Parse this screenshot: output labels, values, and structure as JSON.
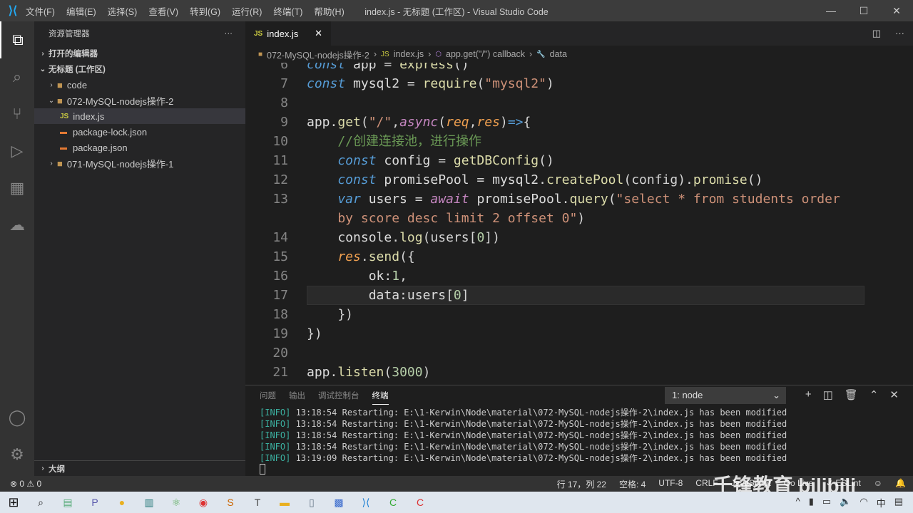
{
  "titlebar": {
    "menu": [
      "文件(F)",
      "编辑(E)",
      "选择(S)",
      "查看(V)",
      "转到(G)",
      "运行(R)",
      "终端(T)",
      "帮助(H)"
    ],
    "title": "index.js - 无标题 (工作区) - Visual Studio Code"
  },
  "sidebar": {
    "title": "资源管理器",
    "more": "···",
    "open_editors": "打开的编辑器",
    "workspace": "无标题 (工作区)",
    "items": [
      {
        "label": "code",
        "type": "folder",
        "depth": 1,
        "open": false
      },
      {
        "label": "072-MySQL-nodejs操作-2",
        "type": "folder",
        "depth": 1,
        "open": true
      },
      {
        "label": "index.js",
        "type": "js",
        "depth": 2,
        "selected": true
      },
      {
        "label": "package-lock.json",
        "type": "json",
        "depth": 2
      },
      {
        "label": "package.json",
        "type": "json",
        "depth": 2
      },
      {
        "label": "071-MySQL-nodejs操作-1",
        "type": "folder",
        "depth": 1,
        "open": false
      }
    ],
    "outline": "大纲"
  },
  "tab": {
    "icon": "JS",
    "label": "index.js",
    "close": "✕"
  },
  "breadcrumb": [
    "072-MySQL-nodejs操作-2",
    "index.js",
    "app.get(\"/\") callback",
    "data"
  ],
  "code": [
    {
      "n": "6",
      "t": [
        [
          "const ",
          "kw"
        ],
        [
          "app ",
          "v"
        ],
        [
          "= ",
          "p"
        ],
        [
          "express",
          "fn"
        ],
        [
          "()",
          "p"
        ]
      ]
    },
    {
      "n": "7",
      "t": [
        [
          "const ",
          "kw"
        ],
        [
          "mysql2 ",
          "v"
        ],
        [
          "= ",
          "p"
        ],
        [
          "require",
          "fn"
        ],
        [
          "(",
          "p"
        ],
        [
          "\"mysql2\"",
          "s"
        ],
        [
          ")",
          "p"
        ]
      ]
    },
    {
      "n": "8",
      "t": []
    },
    {
      "n": "9",
      "t": [
        [
          "app",
          "v"
        ],
        [
          ".",
          "p"
        ],
        [
          "get",
          "fn"
        ],
        [
          "(",
          "p"
        ],
        [
          "\"/\"",
          "s"
        ],
        [
          ",",
          "p"
        ],
        [
          "async",
          "kw2"
        ],
        [
          "(",
          "p"
        ],
        [
          "req",
          "pa"
        ],
        [
          ",",
          "p"
        ],
        [
          "res",
          "pa"
        ],
        [
          ")",
          "p"
        ],
        [
          "=>",
          "kw"
        ],
        [
          "{",
          "p"
        ]
      ]
    },
    {
      "n": "10",
      "t": [
        [
          "    //创建连接池，进行操作",
          "c"
        ]
      ]
    },
    {
      "n": "11",
      "t": [
        [
          "    const ",
          "kw"
        ],
        [
          "config ",
          "v"
        ],
        [
          "= ",
          "p"
        ],
        [
          "getDBConfig",
          "fn"
        ],
        [
          "()",
          "p"
        ]
      ]
    },
    {
      "n": "12",
      "t": [
        [
          "    const ",
          "kw"
        ],
        [
          "promisePool ",
          "v"
        ],
        [
          "= ",
          "p"
        ],
        [
          "mysql2",
          "v"
        ],
        [
          ".",
          "p"
        ],
        [
          "createPool",
          "fn"
        ],
        [
          "(config).",
          "p"
        ],
        [
          "promise",
          "fn"
        ],
        [
          "()",
          "p"
        ]
      ]
    },
    {
      "n": "13",
      "t": [
        [
          "    var ",
          "kw"
        ],
        [
          "users ",
          "v"
        ],
        [
          "= ",
          "p"
        ],
        [
          "await ",
          "kw2"
        ],
        [
          "promisePool",
          "v"
        ],
        [
          ".",
          "p"
        ],
        [
          "query",
          "fn"
        ],
        [
          "(",
          "p"
        ],
        [
          "\"select * from students order",
          "s"
        ]
      ]
    },
    {
      "n": "",
      "t": [
        [
          "    by score desc limit 2 offset 0\"",
          "s"
        ],
        [
          ")",
          "p"
        ]
      ]
    },
    {
      "n": "14",
      "t": [
        [
          "    console",
          "v"
        ],
        [
          ".",
          "p"
        ],
        [
          "log",
          "fn"
        ],
        [
          "(users[",
          "p"
        ],
        [
          "0",
          "n"
        ],
        [
          "])",
          "p"
        ]
      ]
    },
    {
      "n": "15",
      "t": [
        [
          "    res",
          "pa"
        ],
        [
          ".",
          "p"
        ],
        [
          "send",
          "fn"
        ],
        [
          "({",
          "p"
        ]
      ]
    },
    {
      "n": "16",
      "t": [
        [
          "        ok",
          "v"
        ],
        [
          ":",
          "p"
        ],
        [
          "1",
          "n"
        ],
        [
          ",",
          "p"
        ]
      ]
    },
    {
      "n": "17",
      "t": [
        [
          "        data",
          "v"
        ],
        [
          ":",
          "p"
        ],
        [
          "users[",
          "v"
        ],
        [
          "0",
          "n"
        ],
        [
          "]",
          "p"
        ]
      ],
      "current": true
    },
    {
      "n": "18",
      "t": [
        [
          "    })",
          "p"
        ]
      ]
    },
    {
      "n": "19",
      "t": [
        [
          "})",
          "p"
        ]
      ]
    },
    {
      "n": "20",
      "t": []
    },
    {
      "n": "21",
      "t": [
        [
          "app",
          "v"
        ],
        [
          ".",
          "p"
        ],
        [
          "listen",
          "fn"
        ],
        [
          "(",
          "p"
        ],
        [
          "3000",
          "n"
        ],
        [
          ")",
          "p"
        ]
      ]
    }
  ],
  "panel": {
    "tabs": [
      "问题",
      "输出",
      "调试控制台",
      "终端"
    ],
    "active": 3,
    "terminal_select": "1: node",
    "lines": [
      {
        "tag": "[INFO]",
        "text": " 13:18:54 Restarting: E:\\1-Kerwin\\Node\\material\\072-MySQL-nodejs操作-2\\index.js has been modified"
      },
      {
        "tag": "[INFO]",
        "text": " 13:18:54 Restarting: E:\\1-Kerwin\\Node\\material\\072-MySQL-nodejs操作-2\\index.js has been modified"
      },
      {
        "tag": "[INFO]",
        "text": " 13:18:54 Restarting: E:\\1-Kerwin\\Node\\material\\072-MySQL-nodejs操作-2\\index.js has been modified"
      },
      {
        "tag": "[INFO]",
        "text": " 13:18:54 Restarting: E:\\1-Kerwin\\Node\\material\\072-MySQL-nodejs操作-2\\index.js has been modified"
      },
      {
        "tag": "[INFO]",
        "text": " 13:19:09 Restarting: E:\\1-Kerwin\\Node\\material\\072-MySQL-nodejs操作-2\\index.js has been modified"
      }
    ]
  },
  "status": {
    "problems": "⊗ 0 ⚠ 0",
    "position": "行 17，列 22",
    "spaces": "空格: 4",
    "encoding": "UTF-8",
    "eol": "CRLF",
    "language": "JavaScript",
    "golive": "Go Live",
    "eslint": "✓ ESLint"
  },
  "watermark": "千锋教育 bilibili",
  "taskbar": {
    "ime": "中"
  }
}
